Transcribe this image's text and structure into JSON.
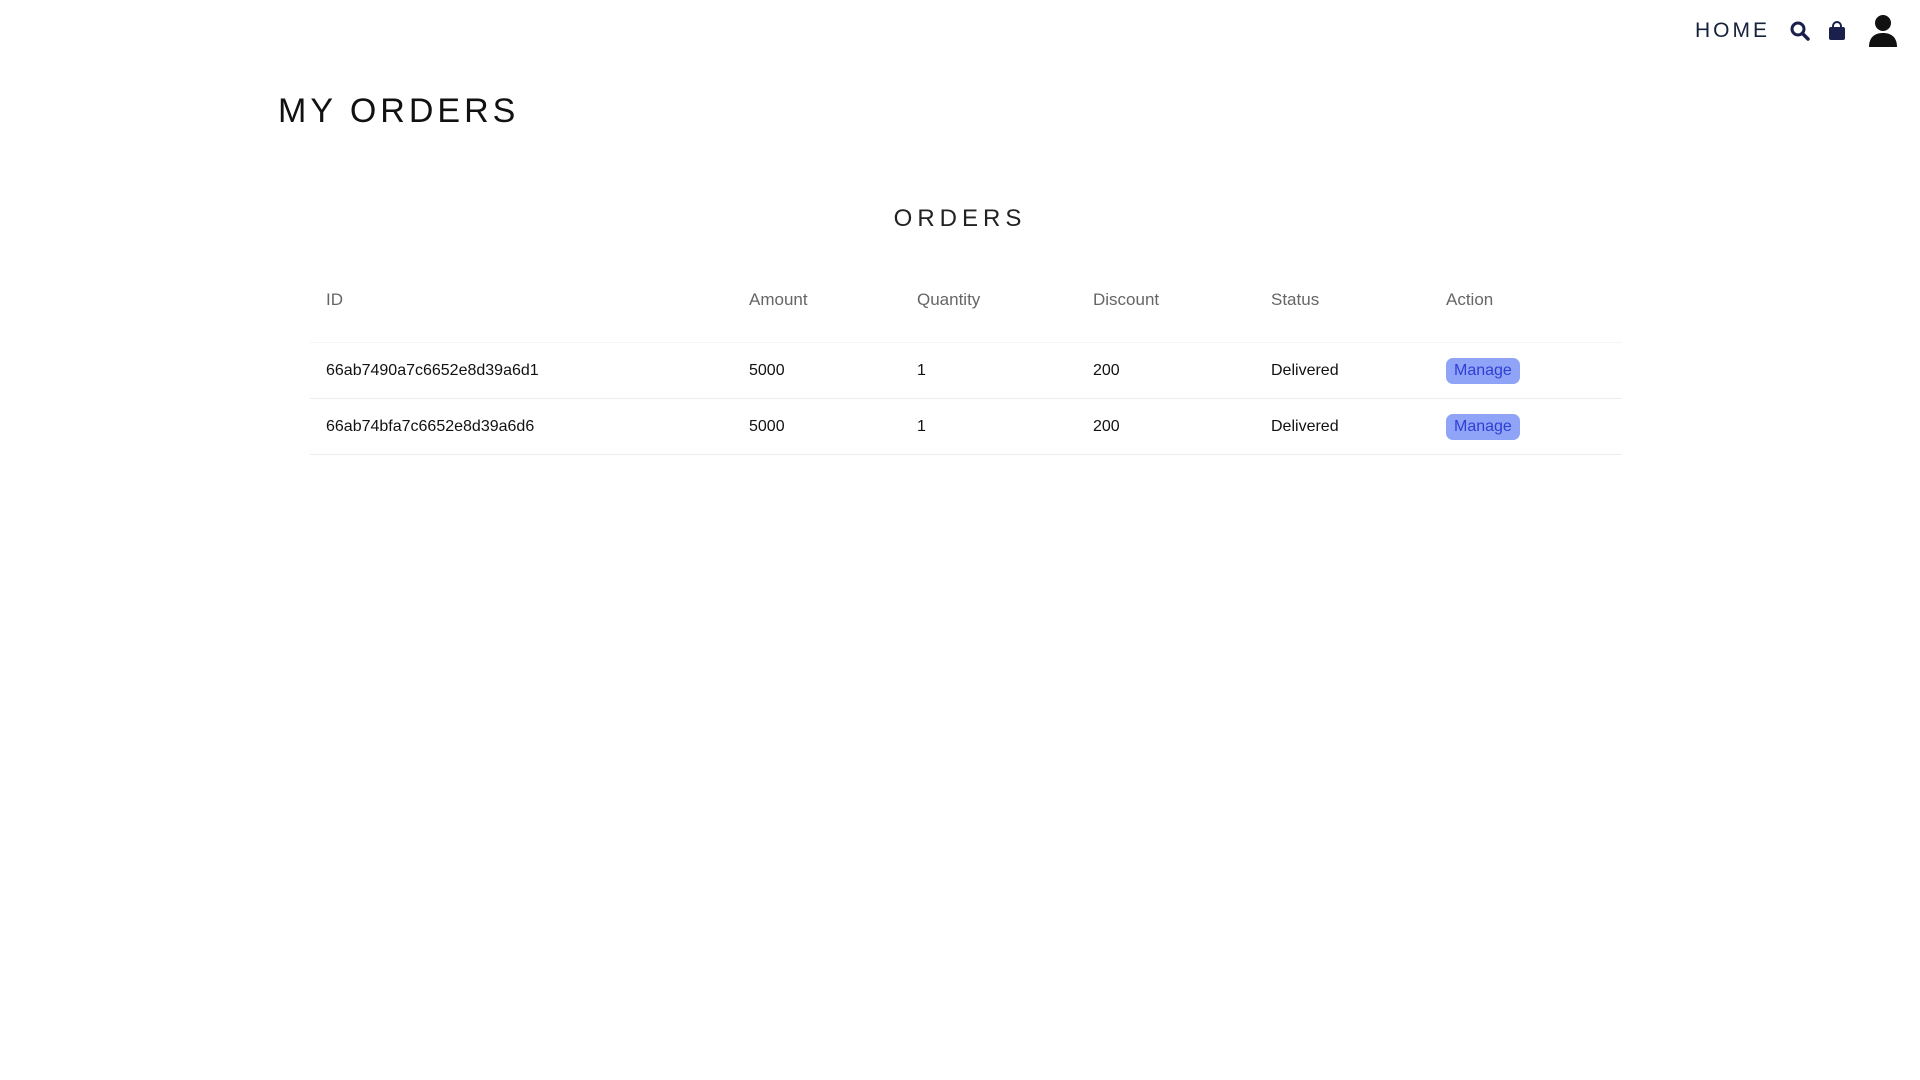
{
  "nav": {
    "home_label": "HOME",
    "icons": [
      "search-icon",
      "shopping-bag-icon",
      "user-icon"
    ],
    "icon_color": "#1b1f4b"
  },
  "page": {
    "title": "MY ORDERS"
  },
  "orders": {
    "section_title": "ORDERS",
    "columns": [
      "ID",
      "Amount",
      "Quantity",
      "Discount",
      "Status",
      "Action"
    ],
    "rows": [
      {
        "id": "66ab7490a7c6652e8d39a6d1",
        "amount": "5000",
        "quantity": "1",
        "discount": "200",
        "status": "Delivered",
        "action": "Manage"
      },
      {
        "id": "66ab74bfa7c6652e8d39a6d6",
        "amount": "5000",
        "quantity": "1",
        "discount": "200",
        "status": "Delivered",
        "action": "Manage"
      }
    ],
    "status_color": "#3b2fe0",
    "button_color": "#8fa3f7"
  }
}
